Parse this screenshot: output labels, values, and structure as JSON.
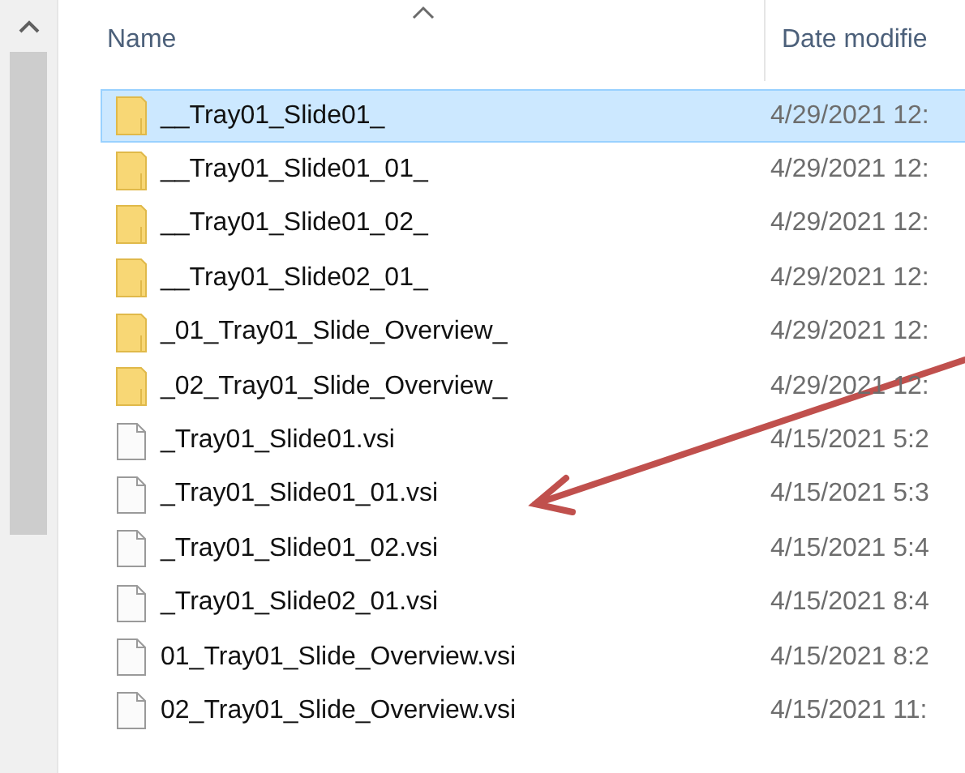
{
  "columns": [
    {
      "label": "Name",
      "sorted": true
    },
    {
      "label": "Date modifie"
    }
  ],
  "rows": [
    {
      "kind": "folder",
      "name": "__Tray01_Slide01_",
      "date": "4/29/2021 12:",
      "selected": true
    },
    {
      "kind": "folder",
      "name": "__Tray01_Slide01_01_",
      "date": "4/29/2021 12:",
      "selected": false
    },
    {
      "kind": "folder",
      "name": "__Tray01_Slide01_02_",
      "date": "4/29/2021 12:",
      "selected": false
    },
    {
      "kind": "folder",
      "name": "__Tray01_Slide02_01_",
      "date": "4/29/2021 12:",
      "selected": false
    },
    {
      "kind": "folder",
      "name": "_01_Tray01_Slide_Overview_",
      "date": "4/29/2021 12:",
      "selected": false
    },
    {
      "kind": "folder",
      "name": "_02_Tray01_Slide_Overview_",
      "date": "4/29/2021 12:",
      "selected": false
    },
    {
      "kind": "file",
      "name": "_Tray01_Slide01.vsi",
      "date": "4/15/2021 5:2",
      "selected": false
    },
    {
      "kind": "file",
      "name": "_Tray01_Slide01_01.vsi",
      "date": "4/15/2021 5:3",
      "selected": false
    },
    {
      "kind": "file",
      "name": "_Tray01_Slide01_02.vsi",
      "date": "4/15/2021 5:4",
      "selected": false
    },
    {
      "kind": "file",
      "name": "_Tray01_Slide02_01.vsi",
      "date": "4/15/2021 8:4",
      "selected": false
    },
    {
      "kind": "file",
      "name": "01_Tray01_Slide_Overview.vsi",
      "date": "4/15/2021 8:2",
      "selected": false
    },
    {
      "kind": "file",
      "name": "02_Tray01_Slide_Overview.vsi",
      "date": "4/15/2021 11:",
      "selected": false
    }
  ],
  "annotation": {
    "kind": "arrow",
    "color": "#c0504d"
  }
}
